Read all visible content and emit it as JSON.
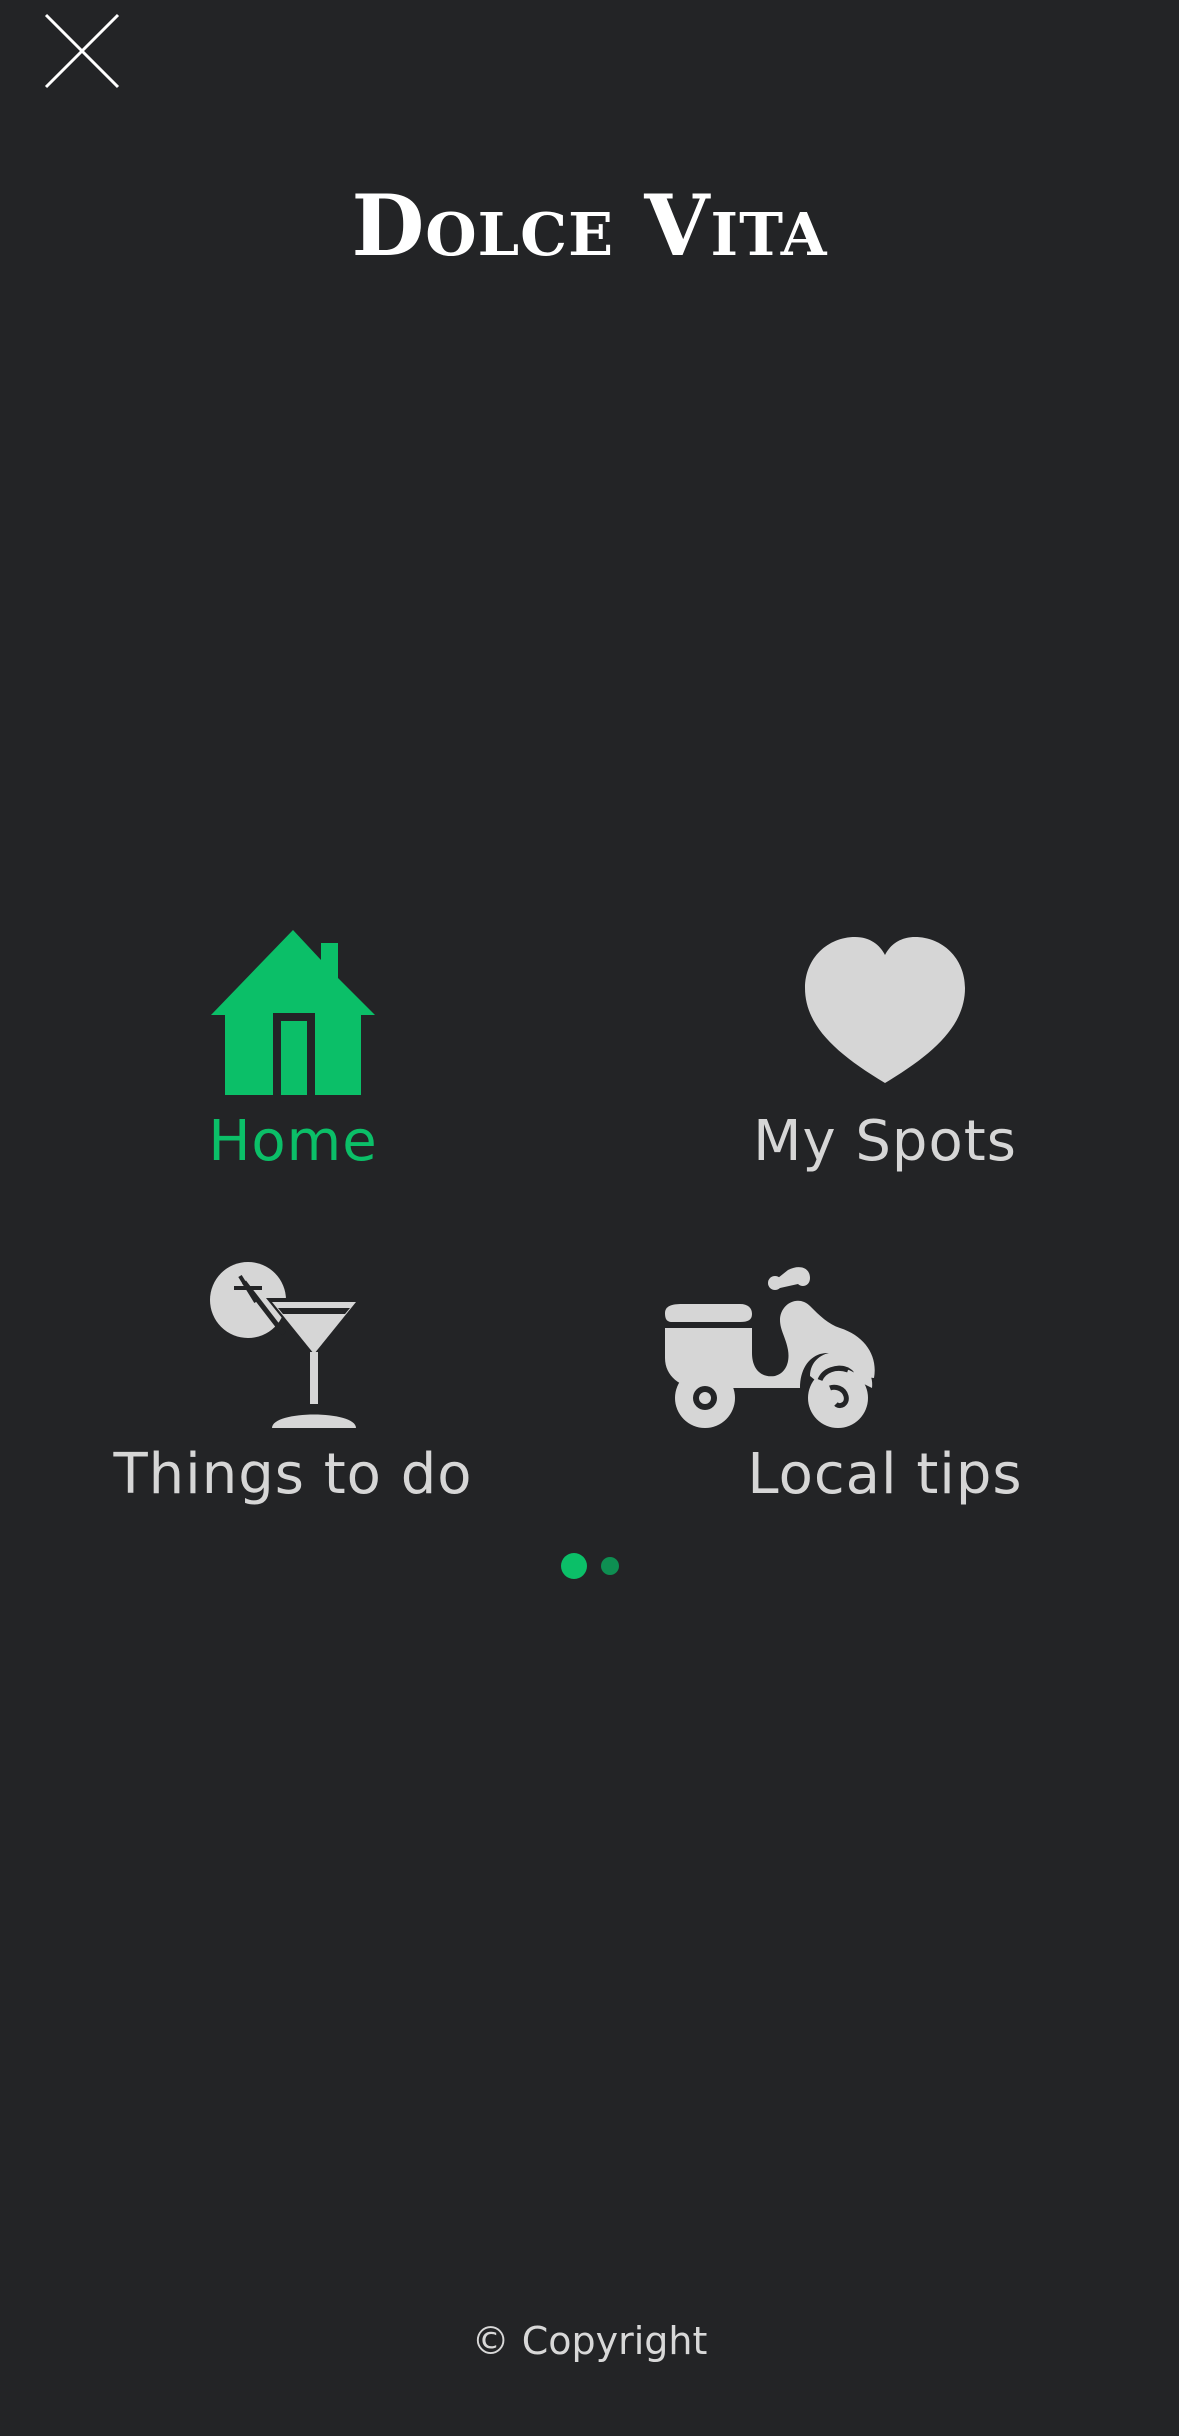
{
  "header": {
    "close_icon": "close-icon",
    "brand": "Dolce Vita"
  },
  "menu": {
    "items": [
      {
        "label": "Home",
        "icon": "house-icon",
        "active": true
      },
      {
        "label": "My Spots",
        "icon": "heart-icon",
        "active": false
      },
      {
        "label": "Things to do",
        "icon": "cocktail-icon",
        "active": false
      },
      {
        "label": "Local tips",
        "icon": "scooter-icon",
        "active": false
      }
    ]
  },
  "pagination": {
    "pages": 2,
    "current": 1
  },
  "footer": {
    "copyright": "© Copyright"
  },
  "colors": {
    "background": "#232426",
    "accent": "#0bbf68",
    "icon": "#d6d6d6",
    "title": "#ffffff"
  }
}
